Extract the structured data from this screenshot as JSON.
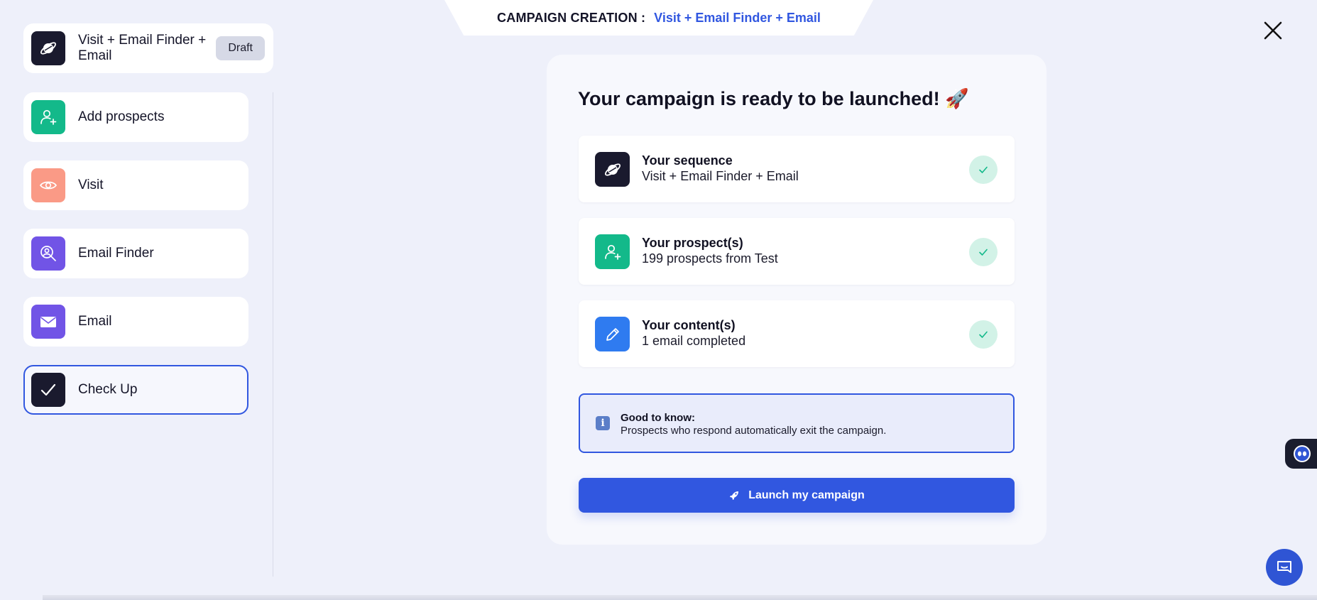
{
  "header": {
    "label": "CAMPAIGN CREATION :",
    "campaign_name": "Visit + Email Finder + Email"
  },
  "sidebar": {
    "campaign": {
      "name": "Visit + Email Finder + Email",
      "status_badge": "Draft",
      "icon": "planet-icon",
      "color": "#1a1a2e"
    },
    "steps": [
      {
        "label": "Add prospects",
        "icon": "user-plus-icon",
        "color": "#13b98a"
      },
      {
        "label": "Visit",
        "icon": "eye-icon",
        "color": "#fa9a86"
      },
      {
        "label": "Email Finder",
        "icon": "email-finder-icon",
        "color": "#7154e6"
      },
      {
        "label": "Email",
        "icon": "envelope-icon",
        "color": "#7154e6"
      },
      {
        "label": "Check Up",
        "icon": "checkmark-icon",
        "color": "#1a1a2e",
        "active": true
      }
    ]
  },
  "main": {
    "title": "Your campaign is ready to be launched! 🚀",
    "summary": [
      {
        "title": "Your sequence",
        "value": "Visit + Email Finder + Email",
        "icon": "planet-icon",
        "color": "#1a1a2e"
      },
      {
        "title": "Your prospect(s)",
        "value": "199 prospects from Test",
        "icon": "user-plus-icon",
        "color": "#13b98a"
      },
      {
        "title": "Your content(s)",
        "value": "1 email completed",
        "icon": "pencil-icon",
        "color": "#2f7bf0"
      }
    ],
    "info": {
      "icon": "info-icon",
      "icon_glyph": "i",
      "heading": "Good to know:",
      "body": "Prospects who respond automatically exit the campaign."
    },
    "launch_button": "Launch my campaign"
  },
  "colors": {
    "accent": "#3157e0",
    "background": "#eef0fa",
    "success_bg": "#d2f2e7",
    "success": "#13b98a"
  }
}
